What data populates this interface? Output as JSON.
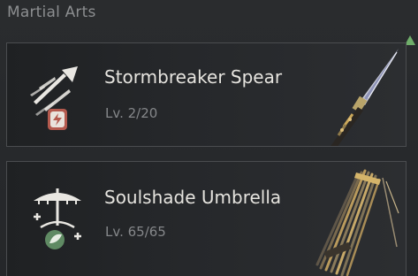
{
  "section": {
    "title": "Martial Arts"
  },
  "items": [
    {
      "name": "Stormbreaker Spear",
      "level": "Lv. 2/20",
      "icon": "spear-skill-icon",
      "badge_icon": "lightning-badge-icon",
      "weapon_image": "spear-weapon-image"
    },
    {
      "name": "Soulshade Umbrella",
      "level": "Lv. 65/65",
      "icon": "umbrella-skill-icon",
      "badge_icon": "leaf-badge-icon",
      "weapon_image": "umbrella-weapon-image"
    }
  ],
  "colors": {
    "scroll_indicator": "#6fae6a",
    "badge_red": "#b45a4e",
    "badge_green": "#5f8a63"
  }
}
